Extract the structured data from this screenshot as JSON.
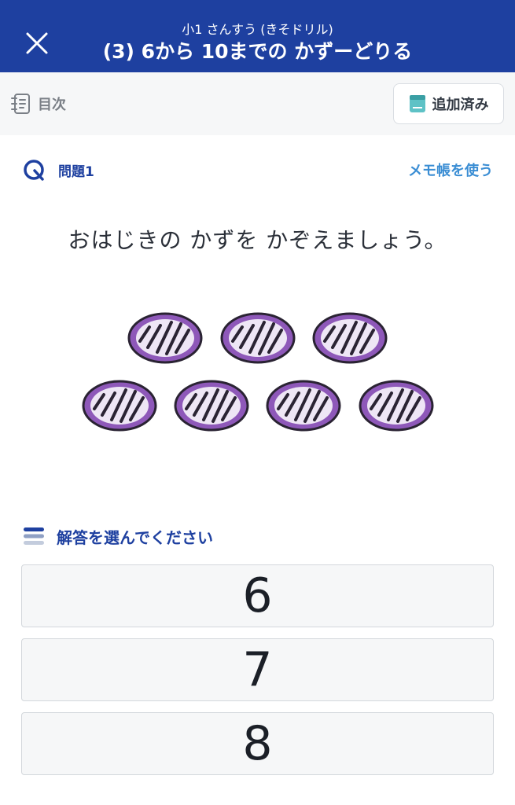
{
  "header": {
    "subtitle": "小1 さんすう (きそドリル)",
    "title": "(3) 6から 10までの かずーどりる"
  },
  "toolbar": {
    "toc_label": "目次",
    "added_label": "追加済み"
  },
  "question": {
    "number_label": "問題1",
    "memo_label": "メモ帳を使う",
    "text": "おはじきの かずを かぞえましょう。",
    "marble_count": 7
  },
  "answers": {
    "heading": "解答を選んでください",
    "choices": [
      "6",
      "7",
      "8"
    ]
  },
  "colors": {
    "header_bg": "#1e40a0",
    "accent_blue": "#1e40a0",
    "link_blue": "#3b8ed4",
    "marble_purple": "#8e58b9"
  }
}
